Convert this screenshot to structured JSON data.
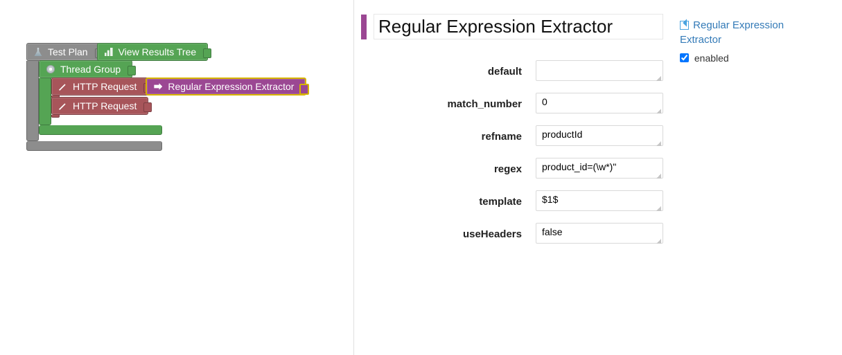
{
  "tree": {
    "test_plan": "Test Plan",
    "view_results": "View Results Tree",
    "thread_group": "Thread Group",
    "http_request_1": "HTTP Request",
    "regex_extractor": "Regular Expression Extractor",
    "http_request_2": "HTTP Request"
  },
  "form": {
    "title": "Regular Expression Extractor",
    "fields": [
      {
        "label": "default",
        "value": ""
      },
      {
        "label": "match_number",
        "value": "0"
      },
      {
        "label": "refname",
        "value": "productId"
      },
      {
        "label": "regex",
        "value": "product_id=(\\w*)\""
      },
      {
        "label": "template",
        "value": "$1$"
      },
      {
        "label": "useHeaders",
        "value": "false"
      }
    ]
  },
  "sidebar": {
    "breadcrumb": "Regular Expression Extractor",
    "enabled_label": "enabled",
    "enabled_checked": true
  }
}
